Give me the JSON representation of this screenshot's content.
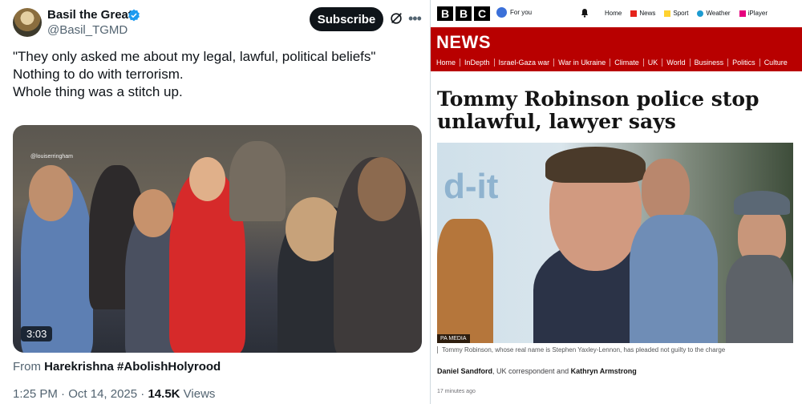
{
  "tweet": {
    "display_name": "Basil the Great",
    "handle": "@Basil_TGMD",
    "subscribe_label": "Subscribe",
    "text_lines": [
      "\"They only asked me about my legal, lawful, political beliefs\"",
      "",
      "Nothing to do with terrorism.",
      "Whole thing was a stitch up."
    ],
    "video_watermark": "@louiserringham",
    "video_duration": "3:03",
    "from_label": "From",
    "from_source": "Harekrishna #AbolishHolyrood",
    "time": "1:25 PM",
    "date": "Oct 14, 2025",
    "views_count": "14.5K",
    "views_label": "Views",
    "verified_color": "#1d9bf0"
  },
  "bbc": {
    "logo_letters": [
      "B",
      "B",
      "C"
    ],
    "for_you_label": "For you",
    "nav_top": [
      {
        "label": "Home",
        "icon": "home"
      },
      {
        "label": "News",
        "icon": "news-icon"
      },
      {
        "label": "Sport",
        "icon": "sport-icon"
      },
      {
        "label": "Weather",
        "icon": "weather-icon"
      },
      {
        "label": "iPlayer",
        "icon": "iplayer-icon"
      }
    ],
    "section_title": "NEWS",
    "news_nav": [
      "Home",
      "InDepth",
      "Israel-Gaza war",
      "War in Ukraine",
      "Climate",
      "UK",
      "World",
      "Business",
      "Politics",
      "Culture"
    ],
    "headline": "Tommy Robinson police stop unlawful, lawyer says",
    "photo_credit": "PA MEDIA",
    "caption": "Tommy Robinson, whose real name is Stephen Yaxley-Lennon, has pleaded not guilty to the charge",
    "byline": {
      "author1": "Daniel Sandford",
      "role": ", UK correspondent and ",
      "author2": "Kathryn Armstrong"
    },
    "timestamp": "17 minutes ago",
    "brand_red": "#b80000"
  }
}
